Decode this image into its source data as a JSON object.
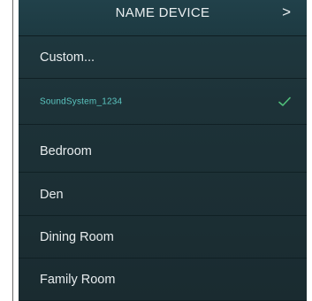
{
  "header": {
    "title": "NAME DEVICE",
    "next_label": ">"
  },
  "list": {
    "items": [
      {
        "label": "Custom...",
        "selected": false
      },
      {
        "label": "SoundSystem_1234",
        "selected": true
      },
      {
        "label": "Bedroom",
        "selected": false
      },
      {
        "label": "Den",
        "selected": false
      },
      {
        "label": "Dining Room",
        "selected": false
      },
      {
        "label": "Family Room",
        "selected": false
      }
    ]
  },
  "colors": {
    "background": "#1d3238",
    "selected_text": "#5cc7c2",
    "checkmark": "#4fc07a",
    "text": "#e7ecee"
  }
}
